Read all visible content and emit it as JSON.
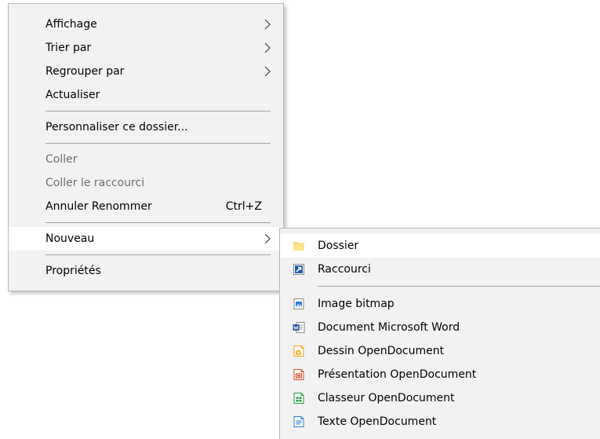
{
  "context_menu": {
    "items": [
      {
        "label": "Affichage",
        "submenu": true
      },
      {
        "label": "Trier par",
        "submenu": true
      },
      {
        "label": "Regrouper par",
        "submenu": true
      },
      {
        "label": "Actualiser"
      },
      {
        "label": "Personnaliser ce dossier..."
      },
      {
        "label": "Coller",
        "disabled": true
      },
      {
        "label": "Coller le raccourci",
        "disabled": true
      },
      {
        "label": "Annuler Renommer",
        "shortcut": "Ctrl+Z"
      },
      {
        "label": "Nouveau",
        "submenu": true,
        "highlighted": true
      },
      {
        "label": "Propriétés"
      }
    ]
  },
  "new_submenu": {
    "items": [
      {
        "label": "Dossier",
        "icon": "folder-icon",
        "highlighted": true
      },
      {
        "label": "Raccourci",
        "icon": "shortcut-icon"
      },
      {
        "label": "Image bitmap",
        "icon": "bitmap-image-icon"
      },
      {
        "label": "Document Microsoft Word",
        "icon": "word-document-icon"
      },
      {
        "label": "Dessin OpenDocument",
        "icon": "opendocument-drawing-icon"
      },
      {
        "label": "Présentation OpenDocument",
        "icon": "opendocument-presentation-icon"
      },
      {
        "label": "Classeur OpenDocument",
        "icon": "opendocument-spreadsheet-icon"
      },
      {
        "label": "Texte OpenDocument",
        "icon": "opendocument-text-icon"
      }
    ]
  },
  "colors": {
    "menu_background": "#f2f2f2",
    "highlight": "#ffffff",
    "disabled_text": "#6d6d6d",
    "word_blue": "#2b579a",
    "draw_orange": "#f0a30a",
    "impress_red": "#d24726",
    "calc_green": "#1e9e3a",
    "writer_blue": "#2a7fd4"
  }
}
